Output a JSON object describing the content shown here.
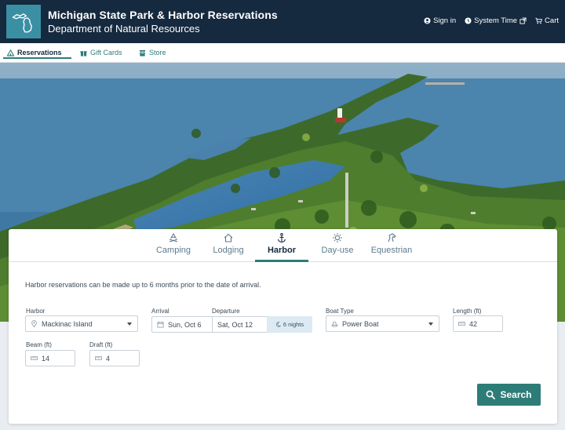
{
  "header": {
    "title": "Michigan State Park & Harbor Reservations",
    "subtitle": "Department of Natural Resources",
    "links": {
      "sign_in": "Sign in",
      "system_time": "System Time",
      "cart": "Cart"
    }
  },
  "nav": {
    "reservations": "Reservations",
    "gift_cards": "Gift Cards",
    "store": "Store"
  },
  "tabs": {
    "camping": "Camping",
    "lodging": "Lodging",
    "harbor": "Harbor",
    "day_use": "Day-use",
    "equestrian": "Equestrian"
  },
  "form": {
    "info": "Harbor reservations can be made up to 6 months prior to the date of arrival.",
    "harbor_label": "Harbor",
    "harbor_value": "Mackinac Island",
    "arrival_label": "Arrival",
    "arrival_value": "Sun, Oct 6",
    "departure_label": "Departure",
    "departure_value": "Sat, Oct 12",
    "nights": "6 nights",
    "boat_type_label": "Boat Type",
    "boat_type_value": "Power Boat",
    "length_label": "Length (ft)",
    "length_value": "42",
    "beam_label": "Beam (ft)",
    "beam_value": "14",
    "draft_label": "Draft (ft)",
    "draft_value": "4",
    "search_label": "Search"
  },
  "colors": {
    "header_bg": "#15293f",
    "accent": "#2e7c78",
    "logo_bg": "#3b8fa3"
  }
}
